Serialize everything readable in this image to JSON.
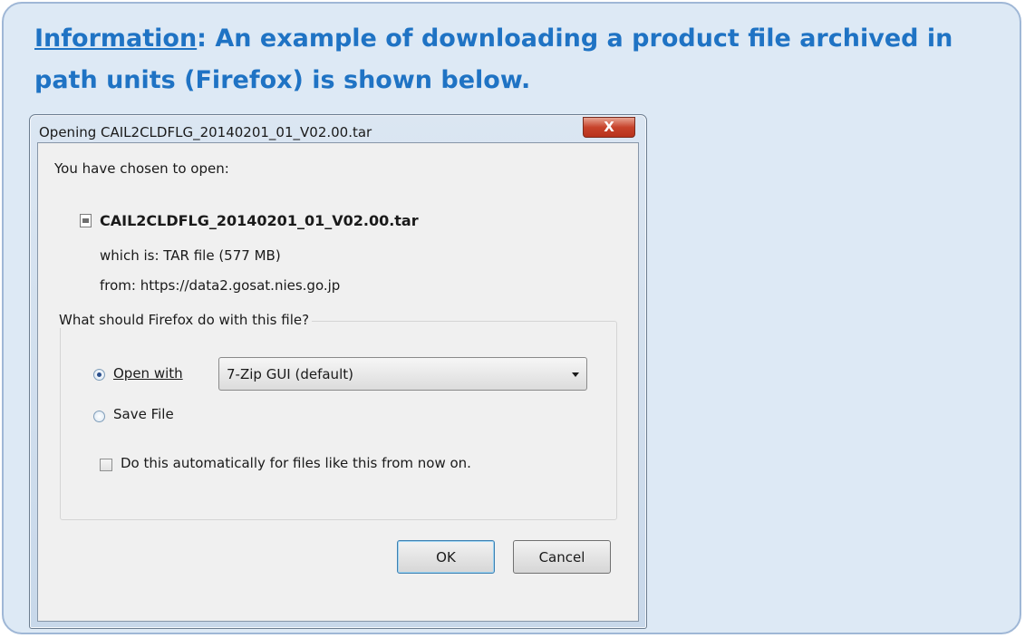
{
  "info": {
    "lead": "Information",
    "text": ": An example of downloading a product file archived in path units (Firefox) is shown below."
  },
  "dialog": {
    "title": "Opening CAIL2CLDFLG_20140201_01_V02.00.tar",
    "close_label": "X",
    "chosen_label": "You have chosen to open:",
    "file_name": "CAIL2CLDFLG_20140201_01_V02.00.tar",
    "file_icon": "file-icon",
    "which_is": "which is: TAR file (577 MB)",
    "from": "from: https://data2.gosat.nies.go.jp",
    "group_label": "What should Firefox do with this file?",
    "open_with_label": "Open with",
    "open_with_selected": true,
    "open_with_value": "7-Zip GUI (default)",
    "save_file_label": "Save File",
    "save_file_selected": false,
    "auto_label": "Do this automatically for files like this from now on.",
    "auto_checked": false,
    "ok_label": "OK",
    "cancel_label": "Cancel"
  },
  "colors": {
    "info_title": "#1f73c4",
    "info_background": "#dde9f5",
    "info_border": "#9fb7d6",
    "close_button": "#c7432b"
  }
}
